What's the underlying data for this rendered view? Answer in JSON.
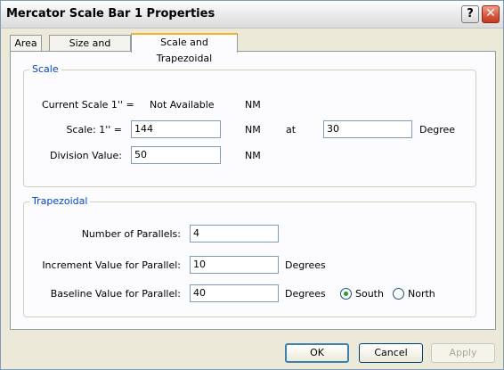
{
  "window": {
    "title": "Mercator Scale Bar 1 Properties",
    "help_glyph": "?",
    "close_glyph": "✕"
  },
  "tabs": [
    {
      "label": "Area"
    },
    {
      "label": "Size and Position"
    },
    {
      "label": "Scale and Trapezoidal",
      "active": true
    }
  ],
  "scale": {
    "group_title": "Scale",
    "current_label": "Current Scale 1'' =",
    "current_value": "Not Available",
    "current_unit": "NM",
    "scale_label": "Scale:  1'' =",
    "scale_value": "144",
    "scale_unit": "NM",
    "at_label": "at",
    "degree_value": "30",
    "degree_unit": "Degree",
    "division_label": "Division Value:",
    "division_value": "50",
    "division_unit": "NM"
  },
  "trapezoidal": {
    "group_title": "Trapezoidal",
    "parallels_label": "Number of Parallels:",
    "parallels_value": "4",
    "increment_label": "Increment Value for Parallel:",
    "increment_value": "10",
    "increment_unit": "Degrees",
    "baseline_label": "Baseline Value for Parallel:",
    "baseline_value": "40",
    "baseline_unit": "Degrees",
    "south_label": "South",
    "north_label": "North",
    "selected_hemisphere": "South"
  },
  "buttons": {
    "ok": "OK",
    "cancel": "Cancel",
    "apply": "Apply"
  },
  "colors": {
    "group_title": "#0046d5",
    "tab_highlight": "#f6b12a",
    "radio_dot": "#21a121"
  }
}
